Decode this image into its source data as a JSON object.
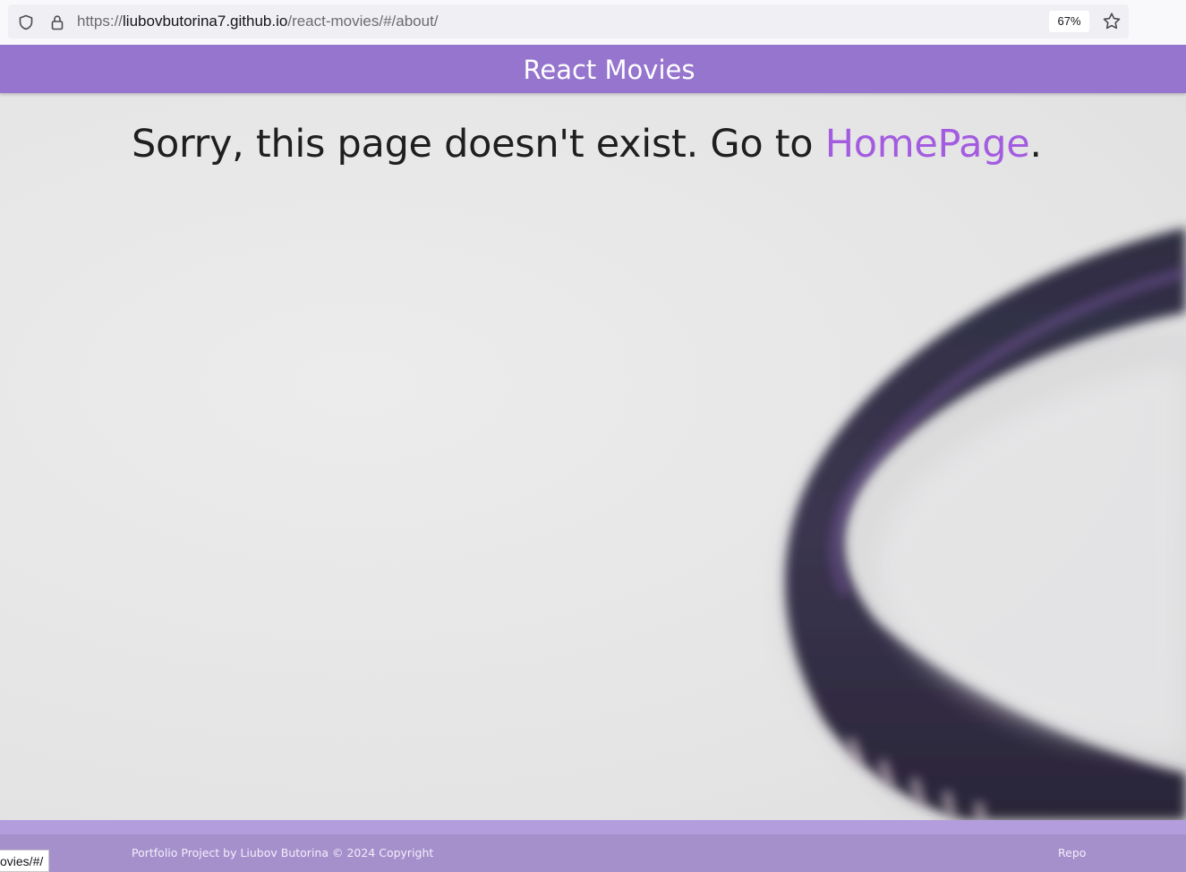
{
  "browser": {
    "url_prefix": "https://",
    "url_host": "liubovbutorina7.github.io",
    "url_path": "/react-movies/#/about/",
    "zoom": "67%"
  },
  "header": {
    "title": "React Movies"
  },
  "main": {
    "message_prefix": "Sorry, this page doesn't exist. Go to ",
    "home_link": "HomePage",
    "message_suffix": "."
  },
  "footer": {
    "copyright": "Portfolio Project by Liubov Butorina © 2024 Copyright",
    "repo_link": "Repo"
  },
  "status_bar": {
    "text": "ovies/#/"
  },
  "colors": {
    "header_bg": "#9675cf",
    "link": "#a35ce0",
    "footer_bg": "#a690cc"
  }
}
